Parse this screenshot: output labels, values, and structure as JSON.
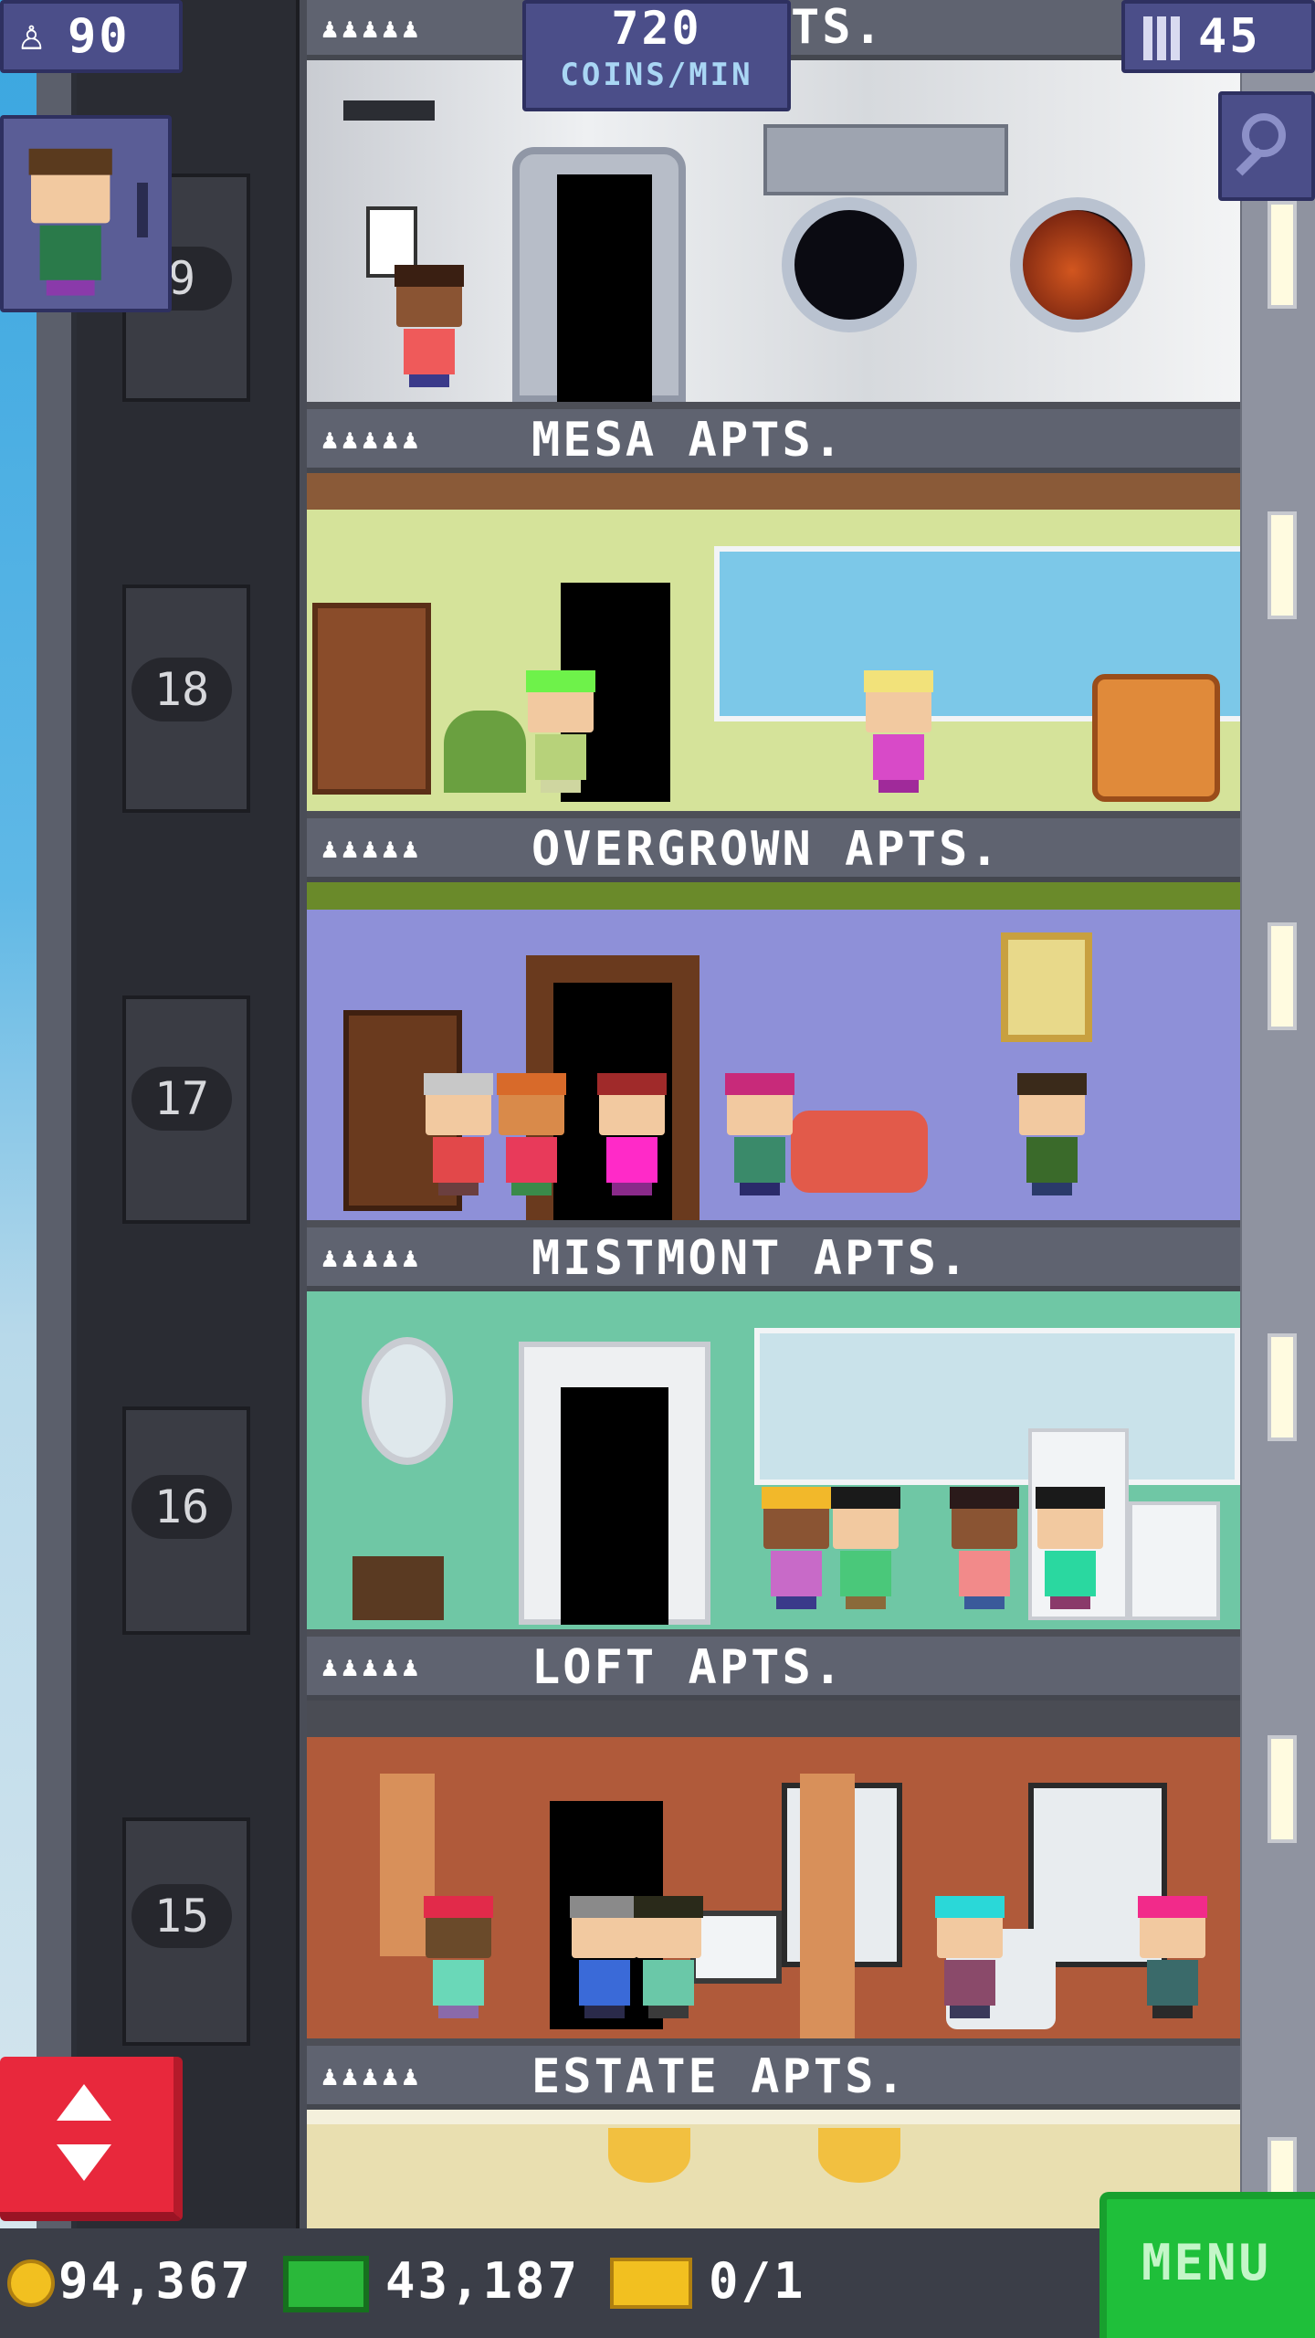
{
  "hud": {
    "population": "90",
    "coins_rate_value": "720",
    "coins_rate_unit": "COINS/MIN",
    "top_floor_name_partial": "TS.",
    "floor_count": "45"
  },
  "floors": [
    {
      "number": "9",
      "name": "MESA APTS."
    },
    {
      "number": "18",
      "name": "OVERGROWN APTS."
    },
    {
      "number": "17",
      "name": "MISTMONT APTS."
    },
    {
      "number": "16",
      "name": "LOFT APTS."
    },
    {
      "number": "15",
      "name": "ESTATE APTS."
    }
  ],
  "resident_icons": "♟♟♟♟♟",
  "bottom_bar": {
    "coins": "94,367",
    "bux": "43,187",
    "tickets": "0/1",
    "menu_label": "MENU"
  },
  "colors": {
    "hud_purple": "#4b4e89",
    "menu_green": "#1fbf3a",
    "elevator_red": "#e8283c"
  },
  "icons": [
    "person-icon",
    "floor-grid-icon",
    "magnifier-icon",
    "elevator-arrows-icon",
    "coin-icon",
    "bux-icon",
    "ticket-icon"
  ]
}
